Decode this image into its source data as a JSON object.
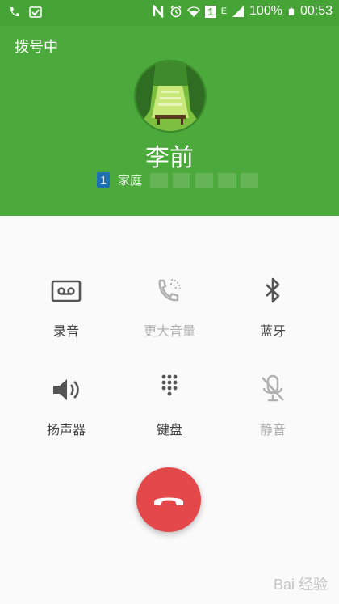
{
  "status_bar": {
    "battery_percent": "100%",
    "time": "00:53",
    "network_label": "E",
    "sim_label": "1",
    "icons": [
      "phone-icon",
      "check-icon",
      "nfc-icon",
      "alarm-icon",
      "wifi-icon",
      "signal-icon",
      "battery-icon"
    ]
  },
  "call": {
    "status": "拨号中",
    "contact_name": "李前",
    "sim_slot": "1",
    "number_label": "家庭"
  },
  "actions": [
    {
      "label": "录音",
      "icon": "cassette-record-icon",
      "enabled": true
    },
    {
      "label": "更大音量",
      "icon": "louder-call-icon",
      "enabled": false
    },
    {
      "label": "蓝牙",
      "icon": "bluetooth-icon",
      "enabled": true
    },
    {
      "label": "扬声器",
      "icon": "speaker-icon",
      "enabled": true
    },
    {
      "label": "键盘",
      "icon": "keypad-icon",
      "enabled": true
    },
    {
      "label": "静音",
      "icon": "mute-icon",
      "enabled": false
    }
  ],
  "end_call": {
    "icon": "end-call-icon",
    "color": "#e5484a"
  },
  "watermark": "Bai 经验",
  "colors": {
    "header": "#4ca93b",
    "status_bar": "#46a436",
    "background": "#fafafa"
  }
}
